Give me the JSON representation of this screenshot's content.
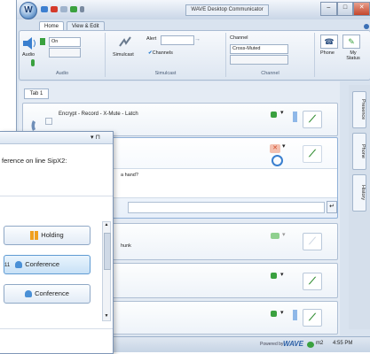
{
  "window": {
    "title": "WAVE Desktop Communicator",
    "logo_letter": "W",
    "controls": [
      "–",
      "□",
      "✕"
    ]
  },
  "ribbon_tabs": [
    "Home",
    "View & Edit"
  ],
  "ribbon": {
    "audio": {
      "label": "Audio",
      "on_value": "On",
      "group": "Audio"
    },
    "simulcast": {
      "simulcast": "Simulcast",
      "alert": "Alert",
      "channels": "Channels",
      "group": "Simulcast"
    },
    "channel": {
      "label": "Channel",
      "value": "Cross-Muted",
      "group": "Channel"
    },
    "phone": {
      "phone": "Phone",
      "my_status": "My Status"
    }
  },
  "content": {
    "tab": "Tab 1",
    "line1_title": "Encrypt - Record - X-Mute - Latch",
    "line2_message": "a hand?",
    "line3_text": "hunk"
  },
  "side_tabs": [
    "Presence",
    "Phone",
    "History"
  ],
  "status_bar": {
    "powered_by": "Powered by",
    "brand": "WAVE",
    "user": "m2",
    "time": "4:55 PM"
  },
  "panel": {
    "pin": "▾ ⊓",
    "message": "ference on line SipX2:",
    "buttons": [
      {
        "label": "Holding",
        "prefix": ""
      },
      {
        "label": "Conference",
        "prefix": "11"
      },
      {
        "label": "Conference",
        "prefix": ""
      }
    ]
  },
  "colors": {
    "accent": "#3a6fb5",
    "hold": "#f0a020",
    "active": "#2e9a36",
    "mute": "#d24a2a"
  }
}
